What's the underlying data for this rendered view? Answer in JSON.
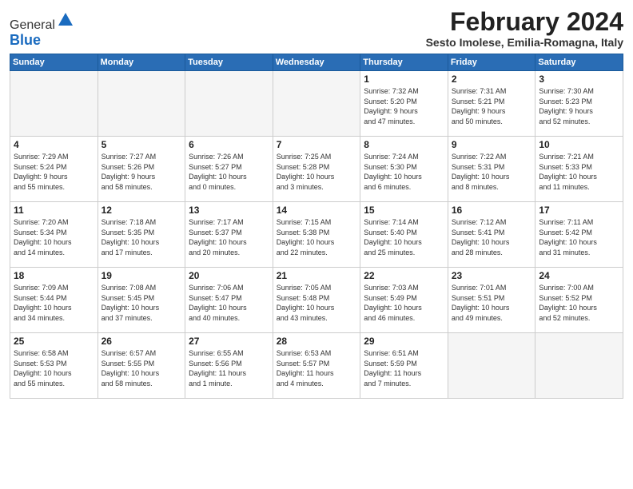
{
  "header": {
    "logo_general": "General",
    "logo_blue": "Blue",
    "month_title": "February 2024",
    "location": "Sesto Imolese, Emilia-Romagna, Italy"
  },
  "weekdays": [
    "Sunday",
    "Monday",
    "Tuesday",
    "Wednesday",
    "Thursday",
    "Friday",
    "Saturday"
  ],
  "weeks": [
    [
      {
        "day": "",
        "info": ""
      },
      {
        "day": "",
        "info": ""
      },
      {
        "day": "",
        "info": ""
      },
      {
        "day": "",
        "info": ""
      },
      {
        "day": "1",
        "info": "Sunrise: 7:32 AM\nSunset: 5:20 PM\nDaylight: 9 hours\nand 47 minutes."
      },
      {
        "day": "2",
        "info": "Sunrise: 7:31 AM\nSunset: 5:21 PM\nDaylight: 9 hours\nand 50 minutes."
      },
      {
        "day": "3",
        "info": "Sunrise: 7:30 AM\nSunset: 5:23 PM\nDaylight: 9 hours\nand 52 minutes."
      }
    ],
    [
      {
        "day": "4",
        "info": "Sunrise: 7:29 AM\nSunset: 5:24 PM\nDaylight: 9 hours\nand 55 minutes."
      },
      {
        "day": "5",
        "info": "Sunrise: 7:27 AM\nSunset: 5:26 PM\nDaylight: 9 hours\nand 58 minutes."
      },
      {
        "day": "6",
        "info": "Sunrise: 7:26 AM\nSunset: 5:27 PM\nDaylight: 10 hours\nand 0 minutes."
      },
      {
        "day": "7",
        "info": "Sunrise: 7:25 AM\nSunset: 5:28 PM\nDaylight: 10 hours\nand 3 minutes."
      },
      {
        "day": "8",
        "info": "Sunrise: 7:24 AM\nSunset: 5:30 PM\nDaylight: 10 hours\nand 6 minutes."
      },
      {
        "day": "9",
        "info": "Sunrise: 7:22 AM\nSunset: 5:31 PM\nDaylight: 10 hours\nand 8 minutes."
      },
      {
        "day": "10",
        "info": "Sunrise: 7:21 AM\nSunset: 5:33 PM\nDaylight: 10 hours\nand 11 minutes."
      }
    ],
    [
      {
        "day": "11",
        "info": "Sunrise: 7:20 AM\nSunset: 5:34 PM\nDaylight: 10 hours\nand 14 minutes."
      },
      {
        "day": "12",
        "info": "Sunrise: 7:18 AM\nSunset: 5:35 PM\nDaylight: 10 hours\nand 17 minutes."
      },
      {
        "day": "13",
        "info": "Sunrise: 7:17 AM\nSunset: 5:37 PM\nDaylight: 10 hours\nand 20 minutes."
      },
      {
        "day": "14",
        "info": "Sunrise: 7:15 AM\nSunset: 5:38 PM\nDaylight: 10 hours\nand 22 minutes."
      },
      {
        "day": "15",
        "info": "Sunrise: 7:14 AM\nSunset: 5:40 PM\nDaylight: 10 hours\nand 25 minutes."
      },
      {
        "day": "16",
        "info": "Sunrise: 7:12 AM\nSunset: 5:41 PM\nDaylight: 10 hours\nand 28 minutes."
      },
      {
        "day": "17",
        "info": "Sunrise: 7:11 AM\nSunset: 5:42 PM\nDaylight: 10 hours\nand 31 minutes."
      }
    ],
    [
      {
        "day": "18",
        "info": "Sunrise: 7:09 AM\nSunset: 5:44 PM\nDaylight: 10 hours\nand 34 minutes."
      },
      {
        "day": "19",
        "info": "Sunrise: 7:08 AM\nSunset: 5:45 PM\nDaylight: 10 hours\nand 37 minutes."
      },
      {
        "day": "20",
        "info": "Sunrise: 7:06 AM\nSunset: 5:47 PM\nDaylight: 10 hours\nand 40 minutes."
      },
      {
        "day": "21",
        "info": "Sunrise: 7:05 AM\nSunset: 5:48 PM\nDaylight: 10 hours\nand 43 minutes."
      },
      {
        "day": "22",
        "info": "Sunrise: 7:03 AM\nSunset: 5:49 PM\nDaylight: 10 hours\nand 46 minutes."
      },
      {
        "day": "23",
        "info": "Sunrise: 7:01 AM\nSunset: 5:51 PM\nDaylight: 10 hours\nand 49 minutes."
      },
      {
        "day": "24",
        "info": "Sunrise: 7:00 AM\nSunset: 5:52 PM\nDaylight: 10 hours\nand 52 minutes."
      }
    ],
    [
      {
        "day": "25",
        "info": "Sunrise: 6:58 AM\nSunset: 5:53 PM\nDaylight: 10 hours\nand 55 minutes."
      },
      {
        "day": "26",
        "info": "Sunrise: 6:57 AM\nSunset: 5:55 PM\nDaylight: 10 hours\nand 58 minutes."
      },
      {
        "day": "27",
        "info": "Sunrise: 6:55 AM\nSunset: 5:56 PM\nDaylight: 11 hours\nand 1 minute."
      },
      {
        "day": "28",
        "info": "Sunrise: 6:53 AM\nSunset: 5:57 PM\nDaylight: 11 hours\nand 4 minutes."
      },
      {
        "day": "29",
        "info": "Sunrise: 6:51 AM\nSunset: 5:59 PM\nDaylight: 11 hours\nand 7 minutes."
      },
      {
        "day": "",
        "info": ""
      },
      {
        "day": "",
        "info": ""
      }
    ]
  ]
}
